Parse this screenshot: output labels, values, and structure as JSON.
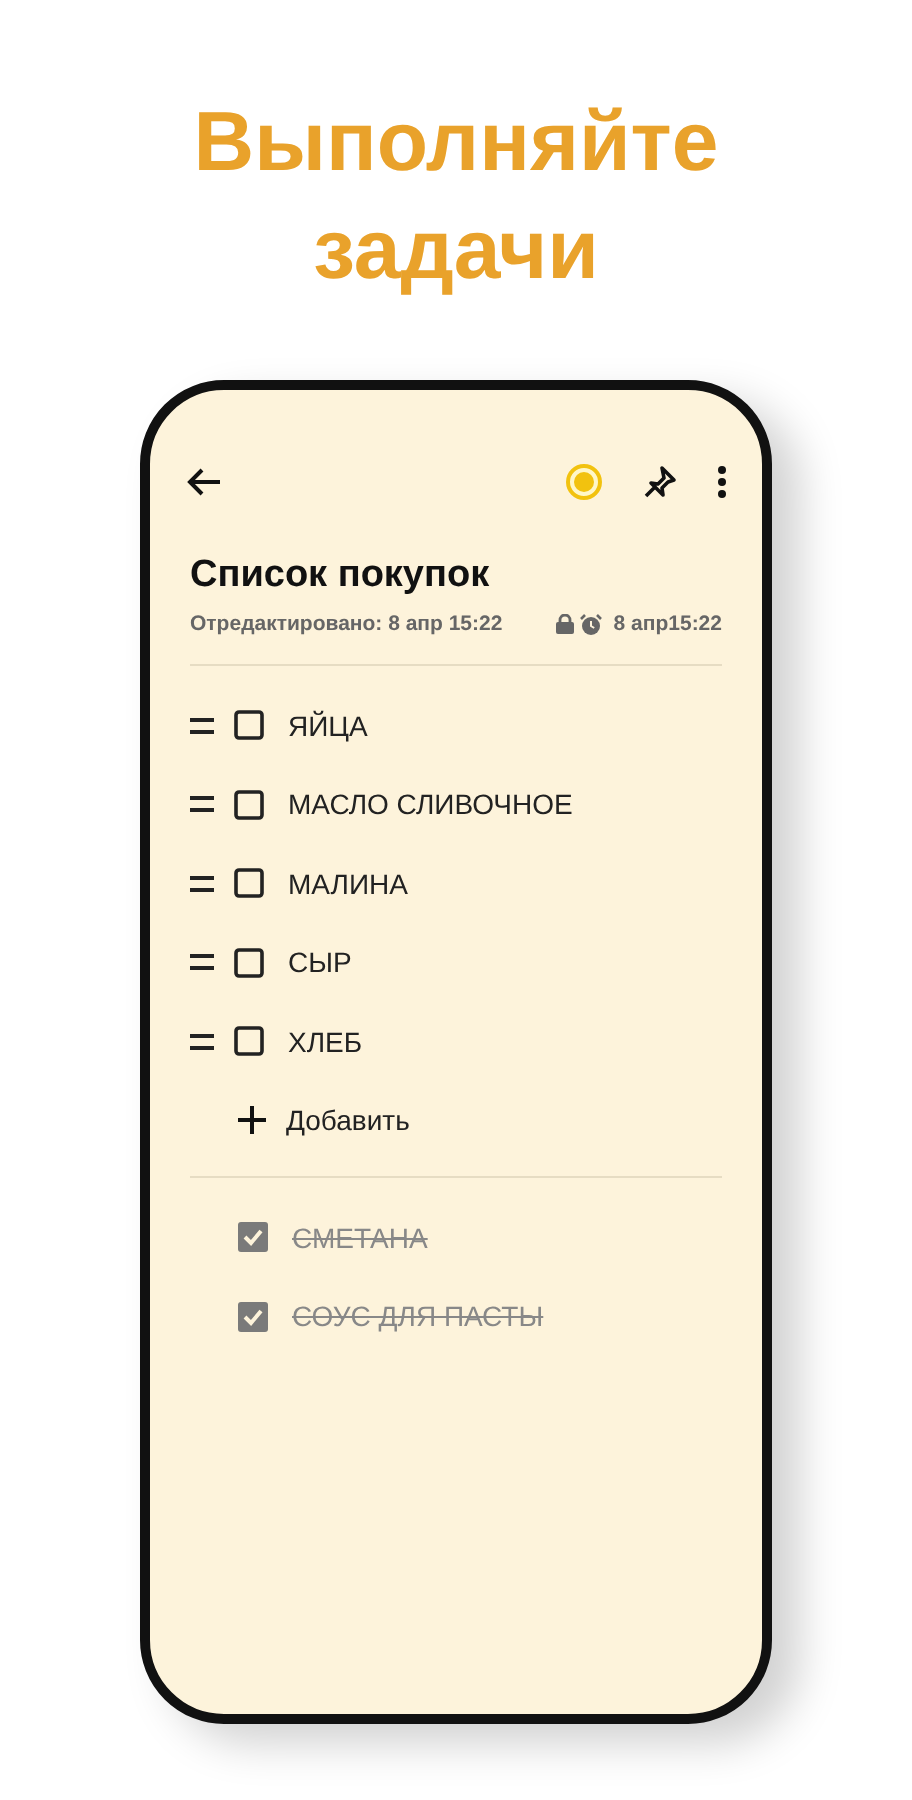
{
  "headline": "Выполняйте задачи",
  "toolbar": {
    "color": "#f2c20f"
  },
  "note": {
    "title": "Список покупок",
    "edited": "Отредактировано: 8 апр 15:22",
    "reminder": "8 апр15:22"
  },
  "items": [
    {
      "label": "ЯЙЦА",
      "checked": false
    },
    {
      "label": "МАСЛО СЛИВОЧНОЕ",
      "checked": false
    },
    {
      "label": "МАЛИНА",
      "checked": false
    },
    {
      "label": "СЫР",
      "checked": false
    },
    {
      "label": "ХЛЕБ",
      "checked": false
    }
  ],
  "add_button": {
    "label": "Добавить"
  },
  "completed_items": [
    {
      "label": "СМЕТАНА",
      "checked": true
    },
    {
      "label": "СОУС ДЛЯ ПАСТЫ",
      "checked": true
    }
  ]
}
